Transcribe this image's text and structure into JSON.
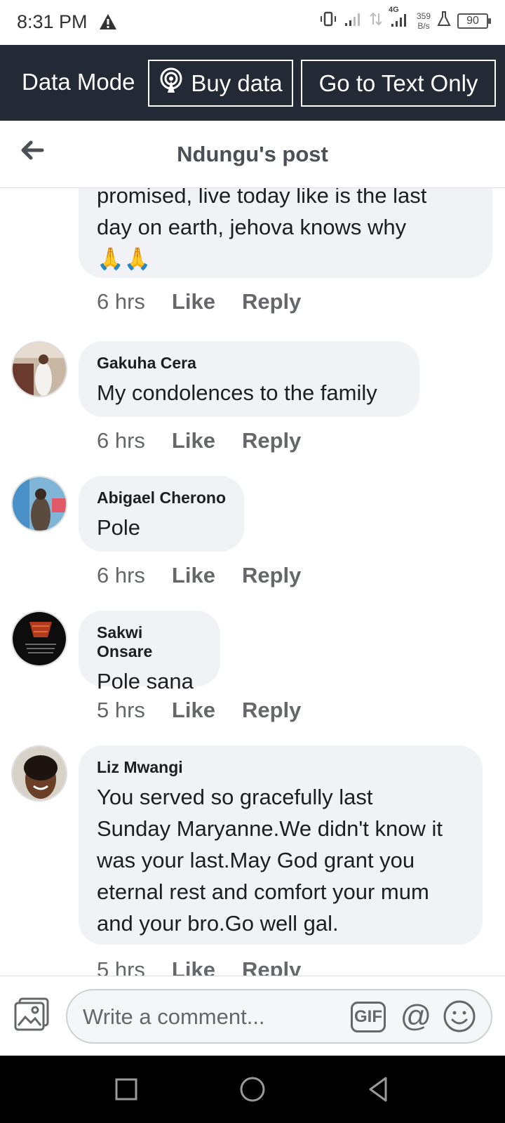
{
  "status_bar": {
    "time": "8:31 PM",
    "network": "4G",
    "speed_value": "359",
    "speed_unit": "B/s",
    "battery": "90",
    "icons": [
      "warning-icon",
      "vibrate-icon",
      "signal-icon",
      "data-arrows-icon",
      "signal-4g-icon",
      "flask-icon",
      "battery-icon"
    ]
  },
  "data_bar": {
    "mode_label": "Data Mode",
    "buy_data_label": "Buy data",
    "text_only_label": "Go to Text Only"
  },
  "header": {
    "title": "Ndungu's post"
  },
  "comments": [
    {
      "author": "",
      "text_lines": [
        "promised, live today like is the last",
        "day on earth, jehova knows why",
        "🙏🙏"
      ],
      "time": "6 hrs",
      "like": "Like",
      "reply": "Reply"
    },
    {
      "author": "Gakuha Cera",
      "text": "My condolences to the family",
      "time": "6 hrs",
      "like": "Like",
      "reply": "Reply"
    },
    {
      "author": "Abigael Cherono",
      "text": "Pole",
      "time": "6 hrs",
      "like": "Like",
      "reply": "Reply"
    },
    {
      "author": "Sakwi Onsare",
      "text": "Pole sana",
      "time": "5 hrs",
      "like": "Like",
      "reply": "Reply"
    },
    {
      "author": "Liz Mwangi",
      "text_lines": [
        "You served so gracefully last",
        "Sunday Maryanne.We didn't know it",
        "was your last.May God grant you",
        "eternal rest and comfort your mum",
        "and your bro.Go well gal."
      ],
      "time": "5 hrs",
      "like": "Like",
      "reply": "Reply"
    }
  ],
  "composer": {
    "placeholder": "Write a comment...",
    "gif_label": "GIF",
    "mention_label": "@"
  },
  "colors": {
    "data_bar_bg": "#242a35",
    "bubble_bg": "#f0f2f5",
    "meta_text": "#65676b"
  }
}
